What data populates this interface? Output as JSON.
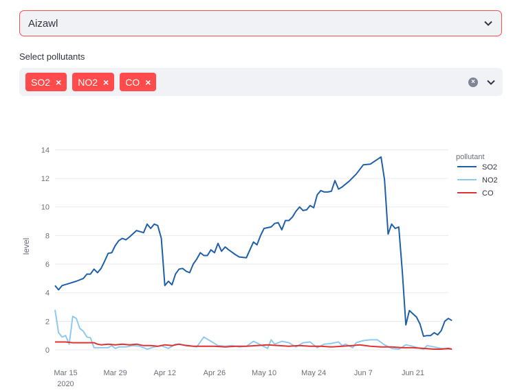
{
  "city_select": {
    "value": "Aizawl",
    "icon": "chevron-down-icon"
  },
  "pollutant_select": {
    "label": "Select pollutants",
    "tags": [
      {
        "label": "SO2",
        "remove": "×"
      },
      {
        "label": "NO2",
        "remove": "×"
      },
      {
        "label": "CO",
        "remove": "×"
      }
    ],
    "clear_icon": "×"
  },
  "colors": {
    "accent": "#ff4b4b",
    "so2": "#1f5fa8",
    "no2": "#8ec9ef",
    "co": "#e03131",
    "grid": "#eaeaea"
  },
  "chart_data": {
    "type": "line",
    "xlabel": "",
    "ylabel": "level",
    "ylim": [
      0,
      14.5
    ],
    "yticks": [
      0,
      2,
      4,
      6,
      8,
      10,
      12,
      14
    ],
    "x_range": [
      "2020-03-12",
      "2020-07-01"
    ],
    "x_ticks": [
      {
        "date": "2020-03-15",
        "label": "Mar 15",
        "sub": "2020"
      },
      {
        "date": "2020-03-29",
        "label": "Mar 29"
      },
      {
        "date": "2020-04-12",
        "label": "Apr 12"
      },
      {
        "date": "2020-04-26",
        "label": "Apr 26"
      },
      {
        "date": "2020-05-10",
        "label": "May 10"
      },
      {
        "date": "2020-05-24",
        "label": "May 24"
      },
      {
        "date": "2020-06-07",
        "label": "Jun 7"
      },
      {
        "date": "2020-06-21",
        "label": "Jun 21"
      }
    ],
    "legend": {
      "title": "pollutant",
      "position": "top-right"
    },
    "series": [
      {
        "name": "SO2",
        "points": [
          [
            "2020-03-12",
            4.5
          ],
          [
            "2020-03-13",
            4.2
          ],
          [
            "2020-03-14",
            4.5
          ],
          [
            "2020-03-16",
            4.65
          ],
          [
            "2020-03-18",
            4.8
          ],
          [
            "2020-03-20",
            5.0
          ],
          [
            "2020-03-21",
            5.3
          ],
          [
            "2020-03-22",
            5.3
          ],
          [
            "2020-03-23",
            5.65
          ],
          [
            "2020-03-24",
            5.4
          ],
          [
            "2020-03-25",
            5.7
          ],
          [
            "2020-03-26",
            6.2
          ],
          [
            "2020-03-27",
            6.75
          ],
          [
            "2020-03-28",
            6.8
          ],
          [
            "2020-03-29",
            7.3
          ],
          [
            "2020-03-30",
            7.65
          ],
          [
            "2020-03-31",
            7.8
          ],
          [
            "2020-04-01",
            7.7
          ],
          [
            "2020-04-02",
            7.9
          ],
          [
            "2020-04-04",
            8.35
          ],
          [
            "2020-04-06",
            8.2
          ],
          [
            "2020-04-07",
            8.8
          ],
          [
            "2020-04-08",
            8.5
          ],
          [
            "2020-04-09",
            8.8
          ],
          [
            "2020-04-10",
            8.7
          ],
          [
            "2020-04-11",
            7.8
          ],
          [
            "2020-04-12",
            4.5
          ],
          [
            "2020-04-13",
            4.8
          ],
          [
            "2020-04-14",
            4.55
          ],
          [
            "2020-04-15",
            5.3
          ],
          [
            "2020-04-16",
            5.65
          ],
          [
            "2020-04-17",
            5.7
          ],
          [
            "2020-04-18",
            5.5
          ],
          [
            "2020-04-19",
            5.4
          ],
          [
            "2020-04-20",
            6.0
          ],
          [
            "2020-04-21",
            6.35
          ],
          [
            "2020-04-22",
            6.8
          ],
          [
            "2020-04-23",
            6.6
          ],
          [
            "2020-04-24",
            6.6
          ],
          [
            "2020-04-25",
            7.0
          ],
          [
            "2020-04-26",
            6.8
          ],
          [
            "2020-04-27",
            7.45
          ],
          [
            "2020-04-28",
            6.9
          ],
          [
            "2020-04-29",
            7.2
          ],
          [
            "2020-04-30",
            7.0
          ],
          [
            "2020-05-02",
            6.65
          ],
          [
            "2020-05-03",
            6.5
          ],
          [
            "2020-05-05",
            6.45
          ],
          [
            "2020-05-06",
            7.0
          ],
          [
            "2020-05-07",
            7.55
          ],
          [
            "2020-05-08",
            7.35
          ],
          [
            "2020-05-09",
            8.0
          ],
          [
            "2020-05-10",
            8.5
          ],
          [
            "2020-05-11",
            8.55
          ],
          [
            "2020-05-12",
            8.6
          ],
          [
            "2020-05-13",
            8.85
          ],
          [
            "2020-05-14",
            8.9
          ],
          [
            "2020-05-15",
            8.4
          ],
          [
            "2020-05-16",
            9.05
          ],
          [
            "2020-05-17",
            9.05
          ],
          [
            "2020-05-18",
            9.3
          ],
          [
            "2020-05-19",
            9.7
          ],
          [
            "2020-05-20",
            10.0
          ],
          [
            "2020-05-21",
            9.75
          ],
          [
            "2020-05-22",
            9.8
          ],
          [
            "2020-05-23",
            10.1
          ],
          [
            "2020-05-24",
            9.95
          ],
          [
            "2020-05-25",
            10.85
          ],
          [
            "2020-05-26",
            11.15
          ],
          [
            "2020-05-27",
            11.05
          ],
          [
            "2020-05-28",
            11.05
          ],
          [
            "2020-05-29",
            11.1
          ],
          [
            "2020-05-30",
            11.85
          ],
          [
            "2020-05-31",
            11.25
          ],
          [
            "2020-06-01",
            11.4
          ],
          [
            "2020-06-03",
            11.8
          ],
          [
            "2020-06-05",
            12.3
          ],
          [
            "2020-06-07",
            12.95
          ],
          [
            "2020-06-09",
            13.0
          ],
          [
            "2020-06-12",
            13.5
          ],
          [
            "2020-06-13",
            11.9
          ],
          [
            "2020-06-14",
            8.1
          ],
          [
            "2020-06-15",
            8.8
          ],
          [
            "2020-06-16",
            8.5
          ],
          [
            "2020-06-17",
            8.6
          ],
          [
            "2020-06-18",
            5.5
          ],
          [
            "2020-06-19",
            1.75
          ],
          [
            "2020-06-20",
            2.75
          ],
          [
            "2020-06-22",
            2.3
          ],
          [
            "2020-06-23",
            1.8
          ],
          [
            "2020-06-24",
            0.95
          ],
          [
            "2020-06-25",
            1.0
          ],
          [
            "2020-06-26",
            1.0
          ],
          [
            "2020-06-27",
            1.2
          ],
          [
            "2020-06-28",
            1.05
          ],
          [
            "2020-06-29",
            1.35
          ],
          [
            "2020-06-30",
            2.0
          ],
          [
            "2020-07-01",
            2.2
          ],
          [
            "2020-07-02",
            2.05
          ]
        ]
      },
      {
        "name": "NO2",
        "points": [
          [
            "2020-03-12",
            2.8
          ],
          [
            "2020-03-13",
            1.2
          ],
          [
            "2020-03-14",
            0.9
          ],
          [
            "2020-03-15",
            1.0
          ],
          [
            "2020-03-16",
            0.4
          ],
          [
            "2020-03-17",
            2.35
          ],
          [
            "2020-03-18",
            2.2
          ],
          [
            "2020-03-19",
            1.5
          ],
          [
            "2020-03-20",
            1.3
          ],
          [
            "2020-03-21",
            0.9
          ],
          [
            "2020-03-22",
            0.85
          ],
          [
            "2020-03-23",
            0.15
          ],
          [
            "2020-03-25",
            0.15
          ],
          [
            "2020-03-27",
            0.15
          ],
          [
            "2020-03-28",
            0.3
          ],
          [
            "2020-03-29",
            0.1
          ],
          [
            "2020-03-30",
            0.2
          ],
          [
            "2020-04-01",
            0.2
          ],
          [
            "2020-04-03",
            0.3
          ],
          [
            "2020-04-05",
            0.25
          ],
          [
            "2020-04-07",
            0.05
          ],
          [
            "2020-04-09",
            0.2
          ],
          [
            "2020-04-11",
            0.3
          ],
          [
            "2020-04-13",
            0.1
          ],
          [
            "2020-04-15",
            0.4
          ],
          [
            "2020-04-17",
            0.35
          ],
          [
            "2020-04-19",
            0.3
          ],
          [
            "2020-04-21",
            0.2
          ],
          [
            "2020-04-23",
            0.9
          ],
          [
            "2020-04-25",
            0.6
          ],
          [
            "2020-04-27",
            0.3
          ],
          [
            "2020-04-29",
            0.25
          ],
          [
            "2020-05-01",
            0.3
          ],
          [
            "2020-05-03",
            0.2
          ],
          [
            "2020-05-05",
            0.25
          ],
          [
            "2020-05-07",
            0.6
          ],
          [
            "2020-05-09",
            0.35
          ],
          [
            "2020-05-11",
            0.1
          ],
          [
            "2020-05-12",
            0.7
          ],
          [
            "2020-05-13",
            0.4
          ],
          [
            "2020-05-15",
            0.6
          ],
          [
            "2020-05-17",
            0.5
          ],
          [
            "2020-05-19",
            0.2
          ],
          [
            "2020-05-21",
            0.5
          ],
          [
            "2020-05-23",
            0.55
          ],
          [
            "2020-05-25",
            0.15
          ],
          [
            "2020-05-27",
            0.4
          ],
          [
            "2020-05-29",
            0.45
          ],
          [
            "2020-05-31",
            0.55
          ],
          [
            "2020-06-01",
            0.3
          ],
          [
            "2020-06-02",
            0.4
          ],
          [
            "2020-06-04",
            0.15
          ],
          [
            "2020-06-05",
            0.5
          ],
          [
            "2020-06-07",
            0.65
          ],
          [
            "2020-06-09",
            0.7
          ],
          [
            "2020-06-11",
            0.7
          ],
          [
            "2020-06-13",
            0.35
          ],
          [
            "2020-06-15",
            0.1
          ],
          [
            "2020-06-17",
            0.05
          ],
          [
            "2020-06-19",
            0.35
          ],
          [
            "2020-06-21",
            0.25
          ],
          [
            "2020-06-23",
            0.1
          ],
          [
            "2020-06-24",
            0.05
          ],
          [
            "2020-06-25",
            0.3
          ],
          [
            "2020-06-27",
            0.2
          ],
          [
            "2020-06-29",
            0.1
          ],
          [
            "2020-07-01",
            0.05
          ],
          [
            "2020-07-02",
            0.05
          ]
        ]
      },
      {
        "name": "CO",
        "points": [
          [
            "2020-03-12",
            0.55
          ],
          [
            "2020-03-15",
            0.55
          ],
          [
            "2020-03-17",
            0.5
          ],
          [
            "2020-03-20",
            0.5
          ],
          [
            "2020-03-23",
            0.5
          ],
          [
            "2020-03-24",
            0.4
          ],
          [
            "2020-03-25",
            0.35
          ],
          [
            "2020-03-27",
            0.4
          ],
          [
            "2020-03-29",
            0.35
          ],
          [
            "2020-03-31",
            0.4
          ],
          [
            "2020-04-02",
            0.35
          ],
          [
            "2020-04-04",
            0.4
          ],
          [
            "2020-04-06",
            0.3
          ],
          [
            "2020-04-08",
            0.3
          ],
          [
            "2020-04-10",
            0.25
          ],
          [
            "2020-04-12",
            0.35
          ],
          [
            "2020-04-14",
            0.3
          ],
          [
            "2020-04-16",
            0.4
          ],
          [
            "2020-04-18",
            0.3
          ],
          [
            "2020-04-20",
            0.25
          ],
          [
            "2020-04-23",
            0.25
          ],
          [
            "2020-04-26",
            0.25
          ],
          [
            "2020-04-29",
            0.2
          ],
          [
            "2020-05-02",
            0.25
          ],
          [
            "2020-05-05",
            0.25
          ],
          [
            "2020-05-08",
            0.3
          ],
          [
            "2020-05-11",
            0.35
          ],
          [
            "2020-05-14",
            0.3
          ],
          [
            "2020-05-17",
            0.25
          ],
          [
            "2020-05-20",
            0.3
          ],
          [
            "2020-05-23",
            0.25
          ],
          [
            "2020-05-26",
            0.25
          ],
          [
            "2020-05-29",
            0.2
          ],
          [
            "2020-06-01",
            0.25
          ],
          [
            "2020-06-04",
            0.3
          ],
          [
            "2020-06-06",
            0.35
          ],
          [
            "2020-06-09",
            0.25
          ],
          [
            "2020-06-12",
            0.2
          ],
          [
            "2020-06-15",
            0.2
          ],
          [
            "2020-06-18",
            0.15
          ],
          [
            "2020-06-21",
            0.15
          ],
          [
            "2020-06-24",
            0.1
          ],
          [
            "2020-06-27",
            0.05
          ],
          [
            "2020-06-29",
            0.05
          ],
          [
            "2020-07-01",
            0.1
          ],
          [
            "2020-07-02",
            0.05
          ]
        ]
      }
    ]
  }
}
